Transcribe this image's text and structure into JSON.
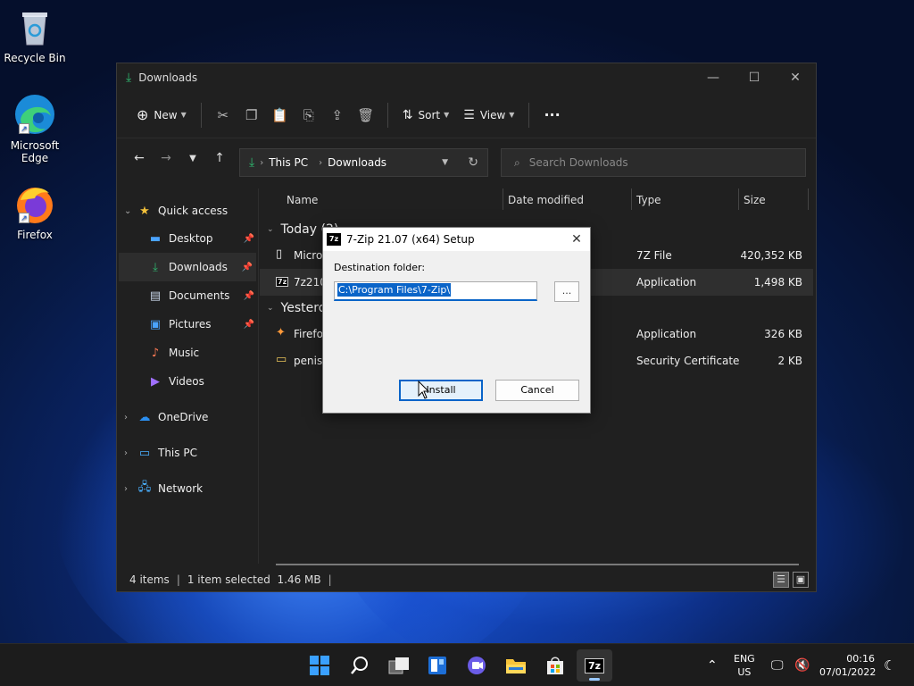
{
  "desktop": {
    "icons": [
      {
        "label": "Recycle Bin"
      },
      {
        "label": "Microsoft Edge"
      },
      {
        "label": "Firefox"
      }
    ]
  },
  "explorer": {
    "title": "Downloads",
    "toolbar": {
      "new_label": "New",
      "sort_label": "Sort",
      "view_label": "View",
      "more_label": "···"
    },
    "address": {
      "segments": [
        "This PC",
        "Downloads"
      ]
    },
    "search": {
      "placeholder": "Search Downloads"
    },
    "sidebar": {
      "items": [
        {
          "label": "Quick access",
          "icon": "star-icon"
        },
        {
          "label": "Desktop",
          "icon": "desktop-icon"
        },
        {
          "label": "Downloads",
          "icon": "download-icon"
        },
        {
          "label": "Documents",
          "icon": "documents-icon"
        },
        {
          "label": "Pictures",
          "icon": "pictures-icon"
        },
        {
          "label": "Music",
          "icon": "music-icon"
        },
        {
          "label": "Videos",
          "icon": "videos-icon"
        },
        {
          "label": "OneDrive",
          "icon": "cloud-icon"
        },
        {
          "label": "This PC",
          "icon": "computer-icon"
        },
        {
          "label": "Network",
          "icon": "network-icon"
        }
      ]
    },
    "columns": [
      "Name",
      "Date modified",
      "Type",
      "Size"
    ],
    "groups": [
      {
        "label": "Today (2)",
        "rows": [
          {
            "name": "Micros",
            "type": "7Z File",
            "size": "420,352 KB"
          },
          {
            "name": "7z2107",
            "type": "Application",
            "size": "1,498 KB"
          }
        ]
      },
      {
        "label": "Yesterda",
        "rows": [
          {
            "name": "Firefox",
            "type": "Application",
            "size": "326 KB"
          },
          {
            "name": "penis",
            "type": "Security Certificate",
            "size": "2 KB"
          }
        ]
      }
    ],
    "status": {
      "items": "4 items",
      "selected": "1 item selected  1.46 MB"
    }
  },
  "dialog": {
    "title": "7-Zip 21.07 (x64) Setup",
    "icon_text": "7z",
    "folder_label": "Destination folder:",
    "folder_value": "C:\\Program Files\\7-Zip\\",
    "browse_label": "...",
    "install_label": "Install",
    "cancel_label": "Cancel",
    "accent": "#0a64c8"
  },
  "taskbar": {
    "app_7z_label": "7z",
    "lang_top": "ENG",
    "lang_bottom": "US",
    "time": "00:16",
    "date": "07/01/2022"
  }
}
